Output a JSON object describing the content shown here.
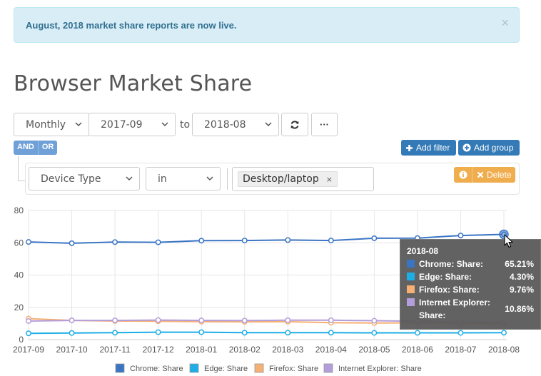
{
  "alert": {
    "text": "August, 2018 market share reports are now live.",
    "close": "×"
  },
  "page_title": "Browser Market Share",
  "controls": {
    "period": "Monthly",
    "from": "2017-09",
    "to_label": "to",
    "to": "2018-08",
    "more": "···"
  },
  "logic": {
    "and": "AND",
    "or": "OR"
  },
  "buttons": {
    "add_filter": "Add filter",
    "add_group": "Add group",
    "delete": "Delete"
  },
  "filter": {
    "field": "Device Type",
    "operator": "in",
    "value": "Desktop/laptop",
    "remove": "×"
  },
  "colors": {
    "chrome": "#3a75c4",
    "edge": "#1eaee6",
    "firefox": "#f6b073",
    "ie": "#b39ddb",
    "accent": "#337ab7",
    "warning": "#f0ad4e"
  },
  "chart_data": {
    "type": "line",
    "x": [
      "2017-09",
      "2017-10",
      "2017-11",
      "2017-12",
      "2018-01",
      "2018-02",
      "2018-03",
      "2018-04",
      "2018-05",
      "2018-06",
      "2018-07",
      "2018-08"
    ],
    "ylim": [
      0,
      80
    ],
    "yticks": [
      "0",
      "20",
      "40",
      "60",
      "80"
    ],
    "grid": true,
    "legend_position": "bottom",
    "series": [
      {
        "name": "Chrome: Share",
        "values": [
          60.5,
          59.7,
          60.4,
          60.3,
          61.3,
          61.4,
          61.7,
          61.4,
          62.8,
          62.9,
          64.5,
          65.21
        ]
      },
      {
        "name": "Edge: Share",
        "values": [
          3.9,
          4.1,
          4.3,
          4.6,
          4.6,
          4.3,
          4.3,
          4.3,
          4.2,
          4.2,
          4.2,
          4.3
        ]
      },
      {
        "name": "Firefox: Share",
        "values": [
          13.0,
          11.9,
          11.5,
          11.4,
          11.1,
          11.0,
          11.1,
          10.5,
          10.3,
          10.4,
          9.9,
          9.76
        ]
      },
      {
        "name": "Internet Explorer: Share",
        "values": [
          11.5,
          11.9,
          11.9,
          12.1,
          11.9,
          11.8,
          12.0,
          12.0,
          11.7,
          11.4,
          11.2,
          10.86
        ]
      }
    ]
  },
  "tooltip": {
    "title": "2018-08",
    "rows": [
      {
        "name": "Chrome: Share:",
        "value": "65.21%"
      },
      {
        "name": "Edge: Share:",
        "value": "4.30%"
      },
      {
        "name": "Firefox: Share:",
        "value": "9.76%"
      },
      {
        "name": "Internet Explorer: Share:",
        "value": "10.86%"
      }
    ]
  }
}
